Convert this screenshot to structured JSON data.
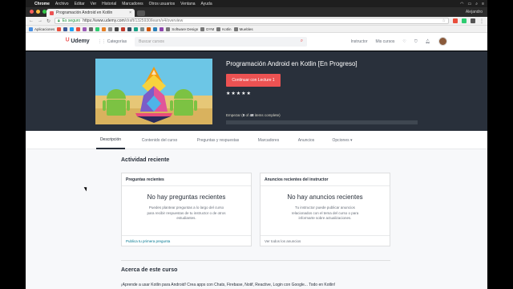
{
  "menubar": {
    "apple": "",
    "app": "Chrome",
    "items": [
      "Archivo",
      "Editar",
      "Ver",
      "Historial",
      "Marcadores",
      "Otros usuarios",
      "Ventana",
      "Ayuda"
    ],
    "user": "Alejandro"
  },
  "browser": {
    "tab_title": "Programación Android en Kotlin",
    "tab_close": "×",
    "secure_label": "Es seguro",
    "url_prefix": "https://www.udemy.com",
    "url_path": "/draft/1325930/learn/v4/overview",
    "star": "☆"
  },
  "bookmarks": [
    {
      "label": "Aplicaciones",
      "color": "#4a90e2"
    },
    {
      "label": "",
      "color": "#e94e3c"
    },
    {
      "label": "",
      "color": "#3b5998"
    },
    {
      "label": "",
      "color": "#1da1f2"
    },
    {
      "label": "",
      "color": "#e94e3c"
    },
    {
      "label": "",
      "color": "#9b59b6"
    },
    {
      "label": "",
      "color": "#666666"
    },
    {
      "label": "",
      "color": "#2ecc71"
    },
    {
      "label": "",
      "color": "#e67e22"
    },
    {
      "label": "",
      "color": "#888888"
    },
    {
      "label": "",
      "color": "#444444"
    },
    {
      "label": "",
      "color": "#c0392b"
    },
    {
      "label": "",
      "color": "#34495e"
    },
    {
      "label": "",
      "color": "#16a085"
    },
    {
      "label": "",
      "color": "#7f8c8d"
    },
    {
      "label": "",
      "color": "#d35400"
    },
    {
      "label": "",
      "color": "#2980b9"
    },
    {
      "label": "",
      "color": "#8e44ad"
    },
    {
      "label": "Software Design",
      "color": "#777777"
    },
    {
      "label": "DYM",
      "color": "#777777"
    },
    {
      "label": "Kotlin",
      "color": "#777777"
    },
    {
      "label": "Muebles",
      "color": "#777777"
    }
  ],
  "header": {
    "logo_text": "Udemy",
    "logo_mark": "ᵁ",
    "categories": "Categorías",
    "search_placeholder": "Buscar cursos",
    "instructor": "Instructor",
    "my_courses": "Mis cursos"
  },
  "course": {
    "title": "Programación Android en Kotlin [En Progreso]",
    "continue_button": "Continuar con Lecture 1",
    "stars": "★★★★★",
    "progress_prefix": "Empezar (",
    "progress_done": "0",
    "progress_of": " of ",
    "progress_total": "48",
    "progress_suffix": " items complete)",
    "progress_fraction": 0
  },
  "tabs": [
    "Descripción",
    "Contenido del curso",
    "Preguntas y respuestas",
    "Marcadores",
    "Anuncios",
    "Opciones ▾"
  ],
  "activity": {
    "title": "Actividad reciente",
    "questions": {
      "header": "Preguntas recientes",
      "big": "No hay preguntas recientes",
      "body": "Puedes plantear preguntas a lo largo del curso para recibir respuestas de tu instructor o de otros estudiantes.",
      "link": "Publica tu primera pregunta"
    },
    "announcements": {
      "header": "Anuncios recientes del instructor",
      "big": "No hay anuncios recientes",
      "body": "Tu instructor puede publicar anuncios relacionados con el tema del curso o para informarte sobre actualizaciones.",
      "link": "Ver todos los anuncios"
    }
  },
  "about": {
    "title": "Acerca de este curso",
    "description": "¡Aprende a usar Kotlin para Android! Crea apps con Chats, Firebase, Notif, Reactive, Login con Google... Todo en Kotlin!"
  },
  "colors": {
    "brand": "#ec5252",
    "hero_bg": "#29303b",
    "link": "#007791"
  }
}
